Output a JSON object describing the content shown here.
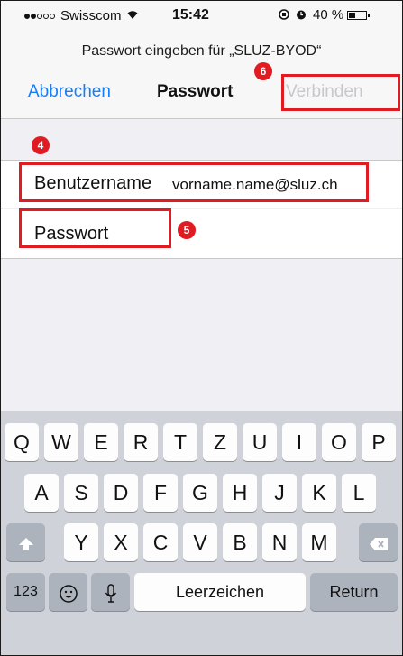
{
  "status_bar": {
    "carrier": "Swisscom",
    "time": "15:42",
    "battery_percent": "40 %",
    "battery_level": 0.4,
    "signal_bars_filled": 2,
    "signal_bars_total": 5
  },
  "nav": {
    "prompt": "Passwort eingeben für „SLUZ-BYOD“",
    "cancel_label": "Abbrechen",
    "title": "Passwort",
    "connect_label": "Verbinden"
  },
  "form": {
    "username_label": "Benutzername",
    "username_value": "vorname.name@sluz.ch",
    "password_label": "Passwort"
  },
  "annotations": {
    "step_username": "4",
    "step_password": "5",
    "step_connect": "6",
    "color": "#e11b22"
  },
  "keyboard": {
    "row1": [
      "Q",
      "W",
      "E",
      "R",
      "T",
      "Z",
      "U",
      "I",
      "O",
      "P"
    ],
    "row2": [
      "A",
      "S",
      "D",
      "F",
      "G",
      "H",
      "J",
      "K",
      "L"
    ],
    "row3": [
      "Y",
      "X",
      "C",
      "V",
      "B",
      "N",
      "M"
    ],
    "numbers_label": "123",
    "space_label": "Leerzeichen",
    "return_label": "Return"
  },
  "colors": {
    "ios_blue": "#157efb",
    "disabled_gray": "#c7c7cc",
    "keyboard_bg": "#cfd3d9"
  }
}
